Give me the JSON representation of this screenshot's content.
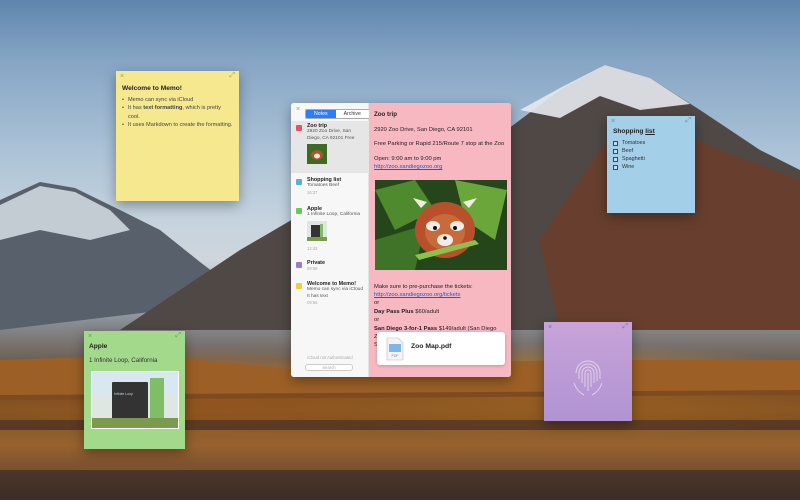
{
  "notes": {
    "yellow": {
      "title": "Welcome to Memo!",
      "line1_a": "Memo can sync via iCloud",
      "line2_a": "It has ",
      "line2_b": "text formatting",
      "line2_c": ", which is pretty cool.",
      "line3_a": "It uses Markdown to create the formatting."
    },
    "blue": {
      "title_a": "Shopping ",
      "title_b": "list",
      "items": [
        "Tomatoes",
        "Beef",
        "Spaghetti",
        "Wine"
      ]
    },
    "green": {
      "title": "Apple",
      "address": "1 Infinite Loop, California",
      "sign_text": "Infinite Loop"
    }
  },
  "window": {
    "tabs": {
      "notes": "Notes",
      "archive": "Archive"
    },
    "list": [
      {
        "title": "Zoo trip",
        "sub": "2920 Zoo Drive, San Diego, CA 92101 Free",
        "color": "#e85067"
      },
      {
        "title": "Shopping list",
        "sub": "Tomatoes Beef",
        "date": "16:37",
        "color": "#5aaede"
      },
      {
        "title": "Apple",
        "sub": "1 Infinite Loop, California",
        "date": "12:42",
        "color": "#66cc55"
      },
      {
        "title": "Private",
        "sub": "",
        "date": "09:56",
        "color": "#9b7ad1"
      },
      {
        "title": "Welcome to Memo!",
        "sub": "Memo can sync via iCloud It has text",
        "date": "09:56",
        "color": "#f2cd3a"
      }
    ],
    "auth": "iCloud not Authenticated",
    "search_placeholder": "Search"
  },
  "content": {
    "title": "Zoo trip",
    "address": "2920 Zoo Drive, San Diego, CA 92101",
    "parking": "Free Parking or Rapid 215/Route 7 stop at the Zoo",
    "open": "Open: 9:00 am to 9:00 pm",
    "site": "http://zoo.sandiegozoo.org",
    "tickets_a": "Make sure to pre-purchase the tickets: ",
    "tickets_link": "http://zoo.sandiegozoo.org/tickets",
    "or1": "or",
    "daypass": "Day Pass Plus",
    "daypass_price": " $60/adult",
    "or2": "or",
    "sd_pass": "San Diego 3-for-1 Pass",
    "sd_rest": " $149/adult (San Diego Zoo, San Diego Zoo Safari Park, and SeaWorld® San Diego)",
    "pdf_name": "Zoo Map.pdf"
  }
}
